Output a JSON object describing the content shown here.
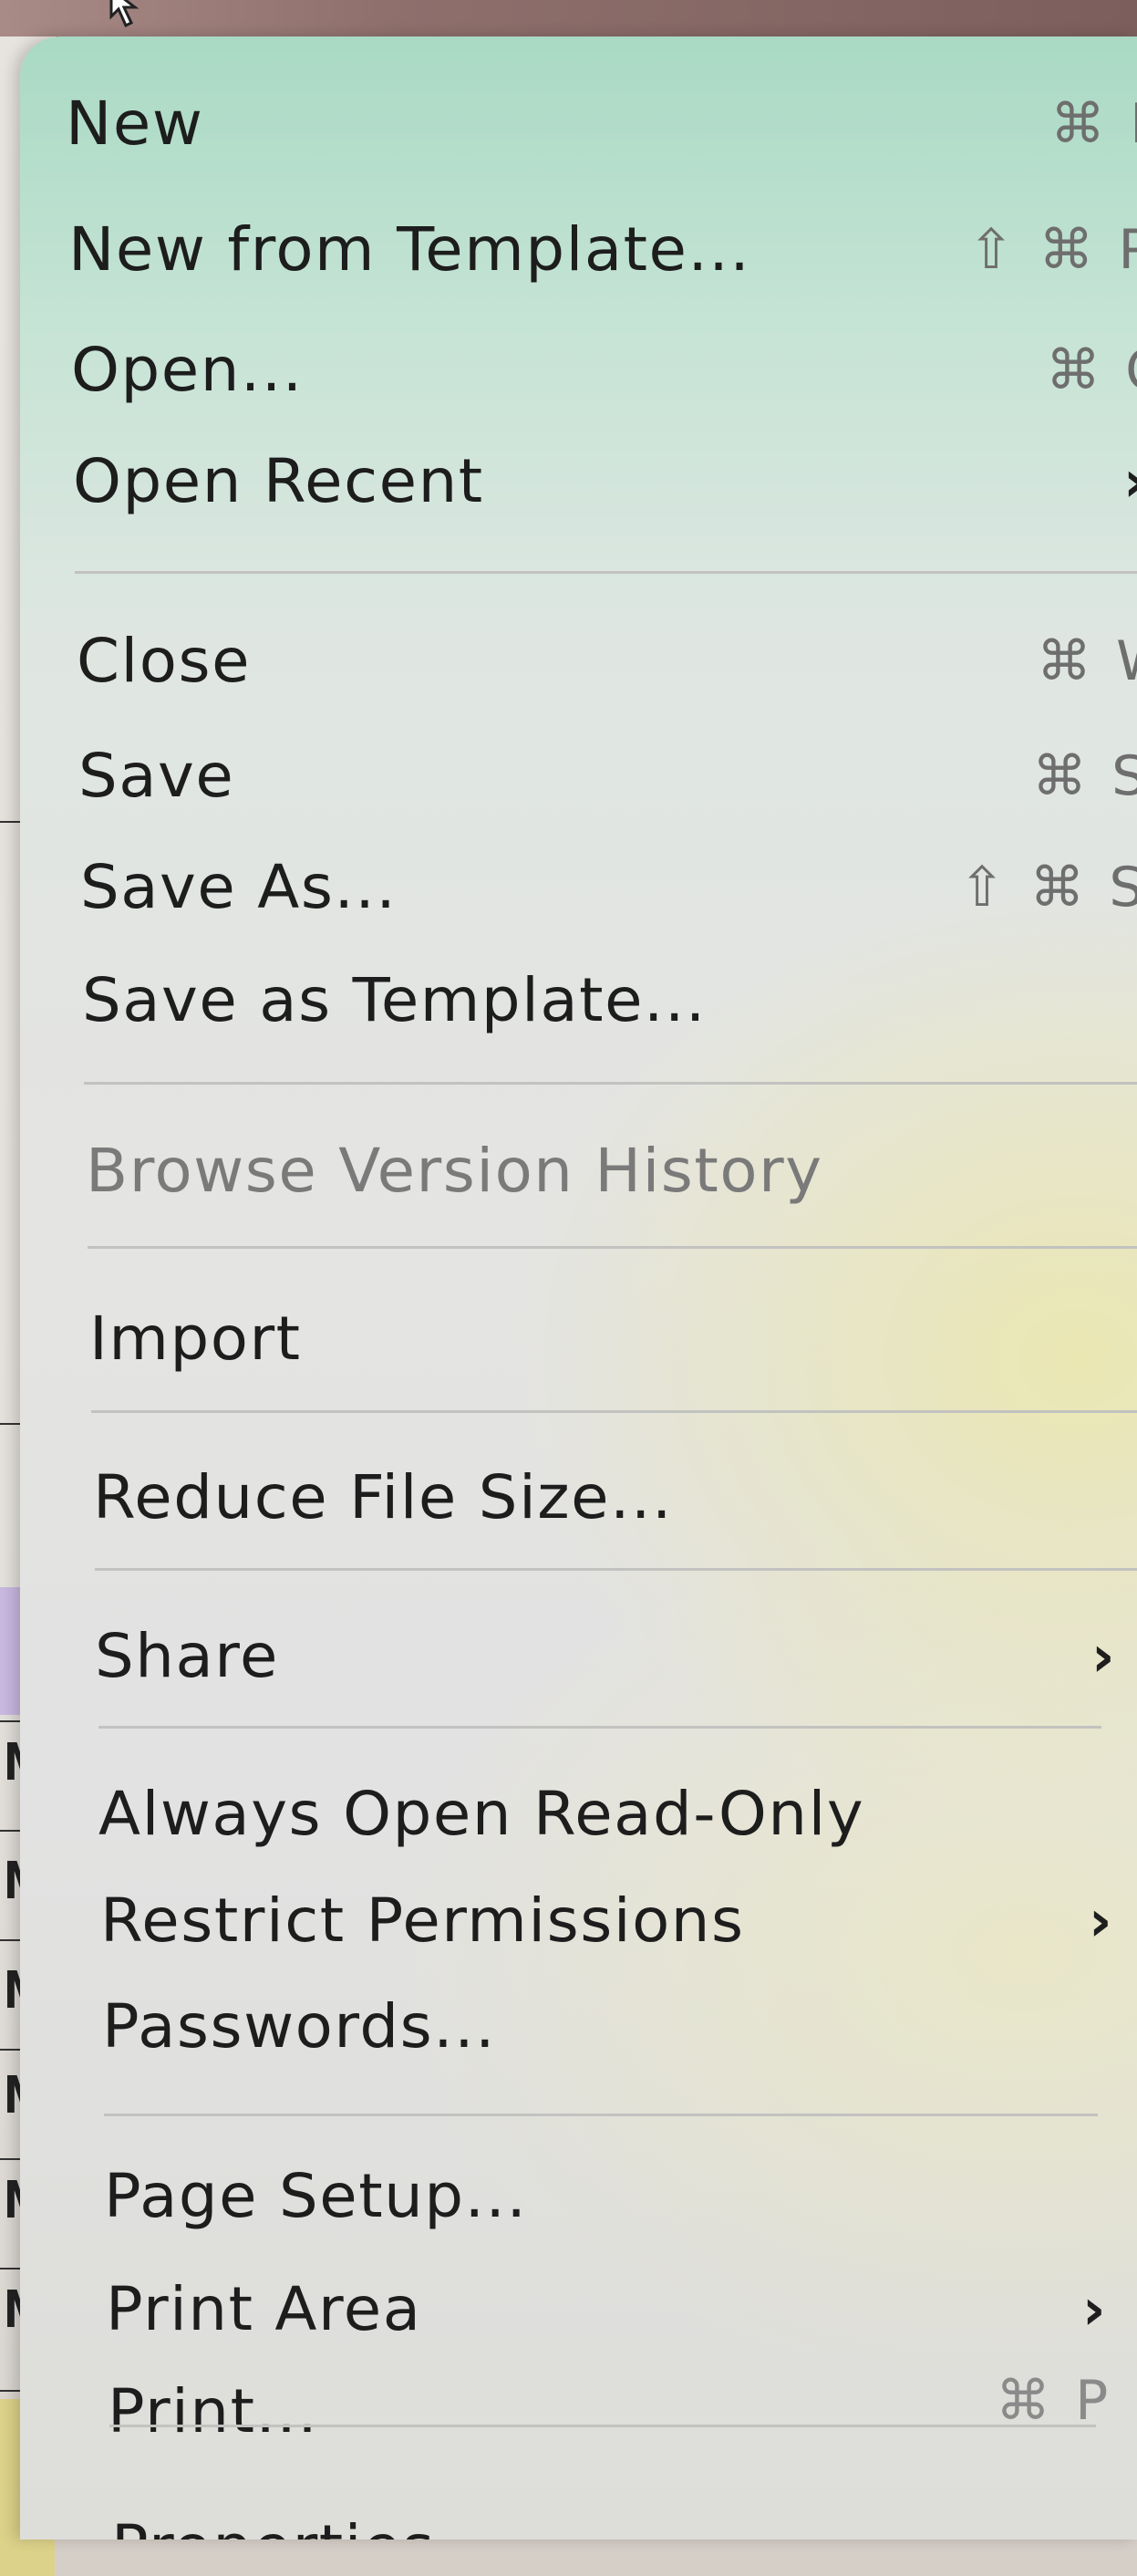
{
  "menu": {
    "items": [
      {
        "label": "New",
        "shortcut": "⌘ N",
        "disabled": false
      },
      {
        "label": "New from Template...",
        "shortcut": "⇧ ⌘ P",
        "disabled": false
      },
      {
        "label": "Open...",
        "shortcut": "⌘ O",
        "disabled": false
      },
      {
        "label": "Open Recent",
        "submenu": true,
        "disabled": false
      },
      {
        "label": "Close",
        "shortcut": "⌘ W",
        "disabled": false
      },
      {
        "label": "Save",
        "shortcut": "⌘ S",
        "disabled": false
      },
      {
        "label": "Save As...",
        "shortcut": "⇧ ⌘ S",
        "disabled": false
      },
      {
        "label": "Save as Template...",
        "disabled": false
      },
      {
        "label": "Browse Version History",
        "disabled": true
      },
      {
        "label": "Import",
        "disabled": false
      },
      {
        "label": "Reduce File Size...",
        "disabled": false
      },
      {
        "label": "Share",
        "submenu": true,
        "disabled": false
      },
      {
        "label": "Always Open Read-Only",
        "disabled": false
      },
      {
        "label": "Restrict Permissions",
        "submenu": true,
        "disabled": false
      },
      {
        "label": "Passwords...",
        "disabled": false
      },
      {
        "label": "Page Setup...",
        "disabled": false
      },
      {
        "label": "Print Area",
        "submenu": true,
        "disabled": false
      },
      {
        "label": "Print...",
        "shortcut": "⌘ P",
        "disabled": false
      },
      {
        "label": "Properties...",
        "disabled": false
      }
    ]
  },
  "background_sheet": {
    "visible_cell_text": [
      "M",
      "M",
      "M",
      "M",
      "M",
      "M"
    ]
  },
  "colors": {
    "menu_text": "#1d1d1d",
    "disabled_text": "#7a7a7a",
    "shortcut_text": "#6e6e6e",
    "separator": "#c2c2c0"
  }
}
